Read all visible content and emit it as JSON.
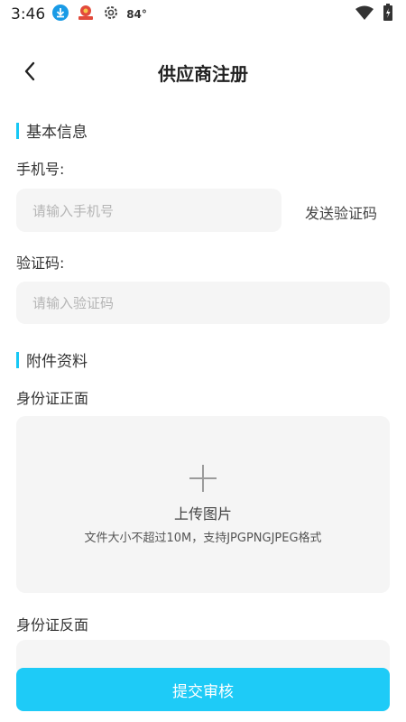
{
  "status_bar": {
    "time": "3:46",
    "temperature": "84°"
  },
  "header": {
    "title": "供应商注册"
  },
  "sections": {
    "basic_info": "基本信息",
    "attachments": "附件资料"
  },
  "form": {
    "phone_label": "手机号:",
    "phone_placeholder": "请输入手机号",
    "send_code_label": "发送验证码",
    "code_label": "验证码:",
    "code_placeholder": "请输入验证码"
  },
  "upload": {
    "id_front_label": "身份证正面",
    "upload_text": "上传图片",
    "upload_hint": "文件大小不超过10M，支持JPGPNGJPEG格式",
    "id_back_label": "身份证反面"
  },
  "footer": {
    "submit_label": "提交审核"
  },
  "colors": {
    "accent": "#1ecbf7",
    "section_bar": "#17c8f5",
    "input_bg": "#f5f5f5"
  }
}
